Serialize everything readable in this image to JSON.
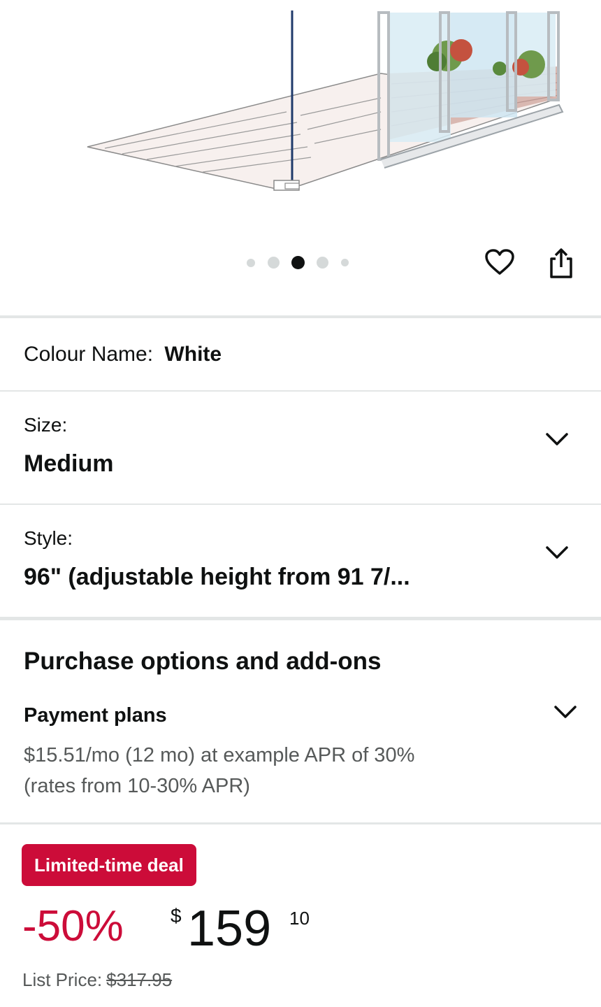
{
  "gallery": {
    "image_alt": "Sliding patio door security bar illustration",
    "dot_count": 5,
    "active_index": 2
  },
  "actions": {
    "wishlist_icon": "heart-icon",
    "share_icon": "share-icon"
  },
  "colour": {
    "label": "Colour Name:",
    "value": "White"
  },
  "size": {
    "label": "Size:",
    "value": "Medium"
  },
  "style": {
    "label": "Style:",
    "value": "96\" (adjustable height from 91 7/..."
  },
  "purchase": {
    "title": "Purchase options and add-ons",
    "payment_title": "Payment plans",
    "payment_desc": "$15.51/mo (12 mo) at example APR of 30% (rates from 10-30% APR)"
  },
  "deal": {
    "badge": "Limited-time deal",
    "discount": "-50%",
    "currency": "$",
    "price_whole": "159",
    "price_fraction": "10",
    "list_price_label": "List Price:",
    "list_price_value": "$317.95"
  },
  "colors": {
    "deal_red": "#cc0c39",
    "text": "#0f1111",
    "muted": "#565959",
    "divider": "#e3e6e6"
  }
}
